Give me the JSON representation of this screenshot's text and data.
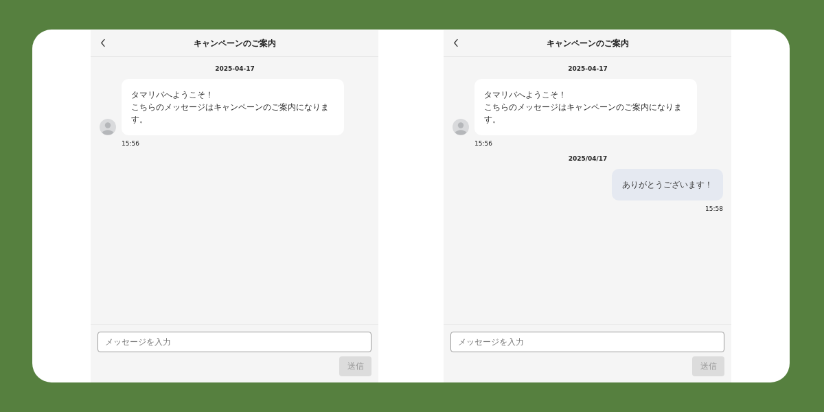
{
  "screens": [
    {
      "header": {
        "title": "キャンペーンのご案内"
      },
      "messages": [
        {
          "kind": "date",
          "text": "2025-04-17"
        },
        {
          "kind": "received",
          "lines": [
            "タマリバへようこそ！",
            "こちらのメッセージはキャンペーンのご案内になります。"
          ],
          "time": "15:56"
        }
      ],
      "input": {
        "placeholder": "メッセージを入力"
      },
      "send": {
        "label": "送信",
        "disabled": true
      }
    },
    {
      "header": {
        "title": "キャンペーンのご案内"
      },
      "messages": [
        {
          "kind": "date",
          "text": "2025-04-17"
        },
        {
          "kind": "received",
          "lines": [
            "タマリバへようこそ！",
            "こちらのメッセージはキャンペーンのご案内になります。"
          ],
          "time": "15:56"
        },
        {
          "kind": "date",
          "text": "2025/04/17"
        },
        {
          "kind": "sent",
          "text": "ありがとうございます！",
          "time": "15:58"
        }
      ],
      "input": {
        "placeholder": "メッセージを入力"
      },
      "send": {
        "label": "送信",
        "disabled": true
      }
    }
  ]
}
